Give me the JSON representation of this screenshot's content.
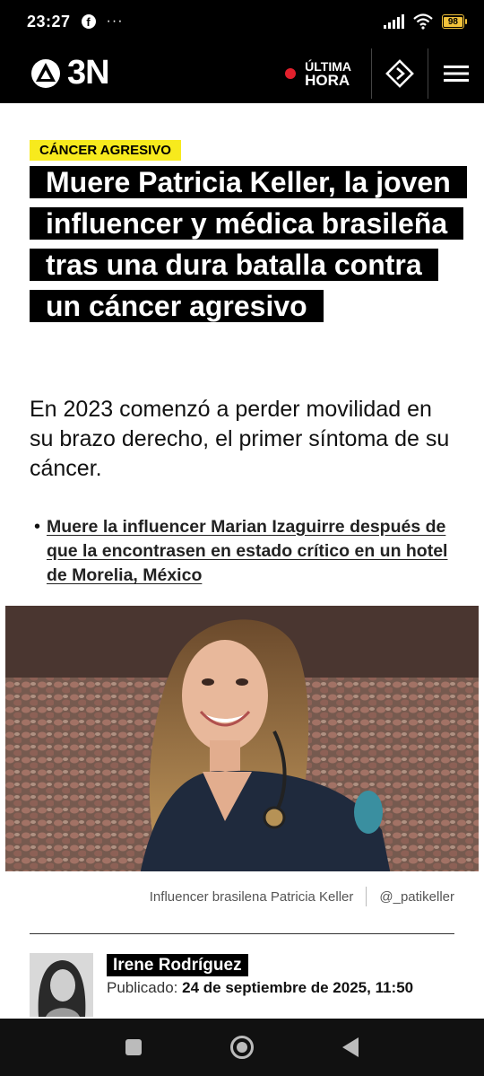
{
  "status_bar": {
    "time": "23:27",
    "notification_icon": "facebook-icon",
    "more": "···",
    "battery": "98"
  },
  "header": {
    "logo_text": "3N",
    "breaking_line1": "ÚLTIMA",
    "breaking_line2": "HORA",
    "accent_color": "#e2202c"
  },
  "article": {
    "tag": "CÁNCER AGRESIVO",
    "headline": "Muere Patricia Keller, la joven influencer y médica brasileña tras una dura batalla contra un cáncer agresivo",
    "subtitle": "En 2023 comenzó a perder movilidad en su brazo derecho, el primer síntoma de su cáncer.",
    "related_link": "Muere la influencer Marian Izaguirre después de que la encontrasen en estado crítico en un hotel de Morelia, México",
    "photo_caption": "Influencer brasilena Patricia Keller",
    "photo_credit": "@_patikeller",
    "author": "Irene Rodríguez",
    "published_label": "Publicado:",
    "published_date": "24 de septiembre de 2025, 11:50"
  },
  "colors": {
    "tag_bg": "#f7ea1d",
    "header_bg": "#000000"
  }
}
